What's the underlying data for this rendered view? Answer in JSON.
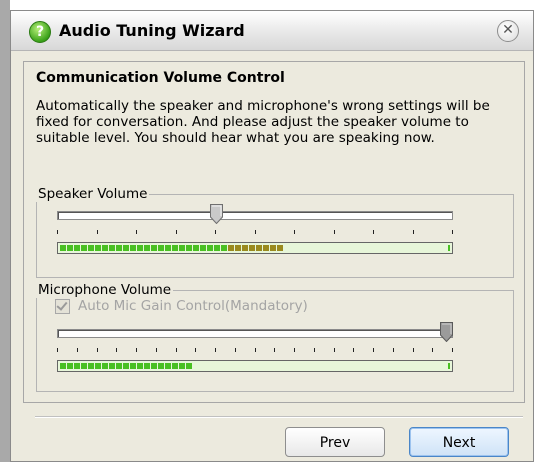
{
  "window": {
    "title": "Audio Tuning Wizard",
    "title_icon": "help-question-icon",
    "close_icon": "close-icon"
  },
  "content": {
    "heading": "Communication Volume Control",
    "description": "Automatically the speaker and microphone's wrong settings will be fixed for conversation. And please adjust the speaker volume to suitable level. You should hear what you are speaking now."
  },
  "speaker": {
    "legend": "Speaker Volume",
    "slider_level": 0.4,
    "meter_level": 0.58,
    "tick_count": 11
  },
  "microphone": {
    "legend": "Microphone Volume",
    "auto_gain_label": "Auto Mic Gain Control(Mandatory)",
    "auto_gain_checked": true,
    "auto_gain_enabled": false,
    "slider_level": 1.0,
    "meter_level": 0.34,
    "tick_count": 21
  },
  "buttons": {
    "prev": "Prev",
    "next": "Next"
  },
  "colors": {
    "meter_green": "#49c022",
    "meter_olive": "#9a8a1e",
    "meter_bg": "#e7f6d9",
    "next_border": "#4a86c8"
  }
}
